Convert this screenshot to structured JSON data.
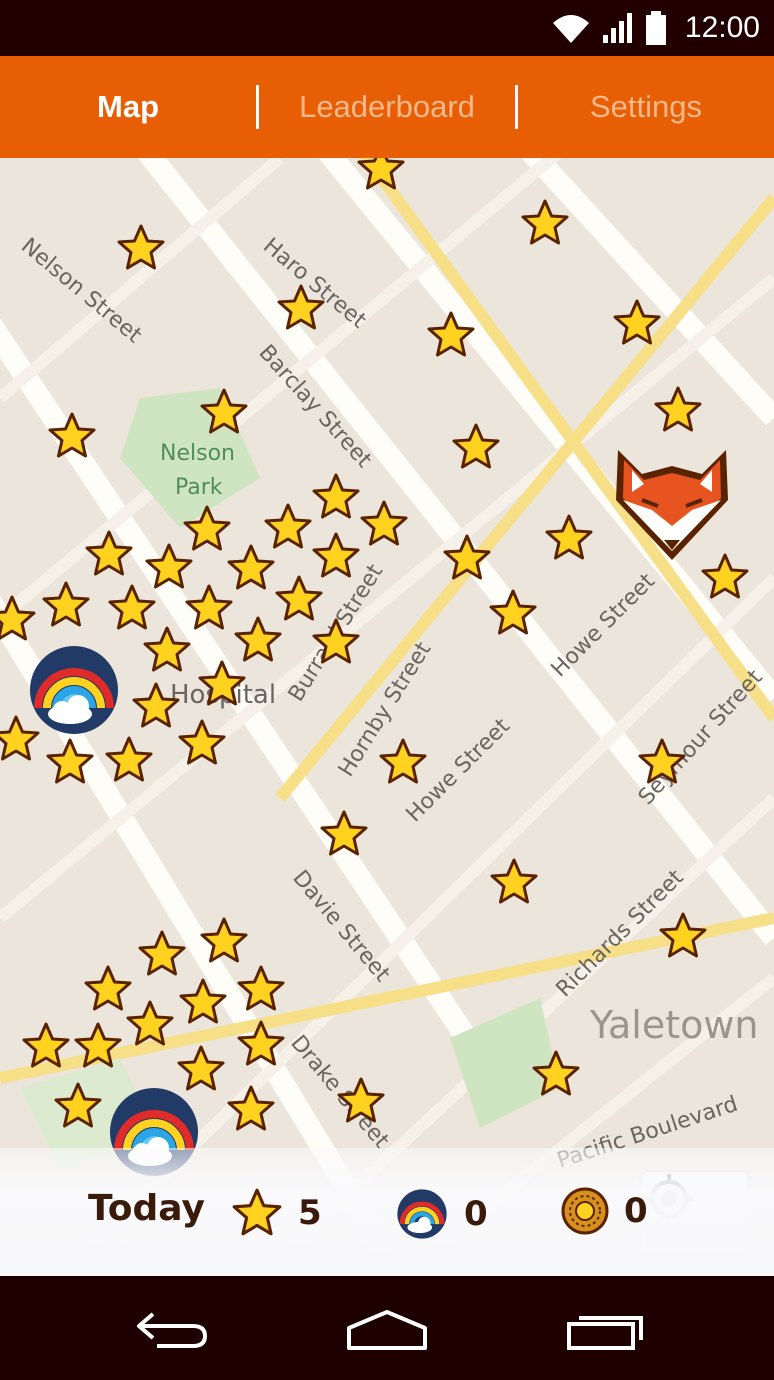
{
  "status_bar": {
    "time": "12:00",
    "icons": [
      "wifi-icon",
      "cell-signal-icon",
      "battery-icon"
    ]
  },
  "tabs": [
    {
      "label": "Map",
      "active": true
    },
    {
      "label": "Leaderboard",
      "active": false
    },
    {
      "label": "Settings",
      "active": false
    }
  ],
  "map": {
    "streets": [
      "Nelson Street",
      "Haro Street",
      "Barclay Street",
      "Hornby Street",
      "Burrard Street",
      "Howe Street",
      "Seymour Street",
      "Davie Street",
      "Richards Street",
      "Drake Street",
      "Pacific Boulevard"
    ],
    "areas": [
      "Nelson Park",
      "St. Paul's Hospital",
      "Yaletown"
    ],
    "player_marker": "fox-icon",
    "collectibles": [
      "star-icon",
      "rainbow-icon"
    ]
  },
  "locate_button": {
    "icon": "crosshair-icon"
  },
  "stats": {
    "today_label": "Today",
    "stars": {
      "icon": "star-icon",
      "count": "5"
    },
    "rainbows": {
      "icon": "rainbow-icon",
      "count": "0"
    },
    "suns": {
      "icon": "sun-coin-icon",
      "count": "0"
    }
  },
  "nav": {
    "icons": [
      "back-icon",
      "home-icon",
      "recents-icon"
    ]
  },
  "colors": {
    "tab_bar": "#e85e05",
    "status_bar": "#230000",
    "star_fill": "#ffd21f",
    "star_outline": "#5a2300",
    "fox": "#e8541f"
  }
}
